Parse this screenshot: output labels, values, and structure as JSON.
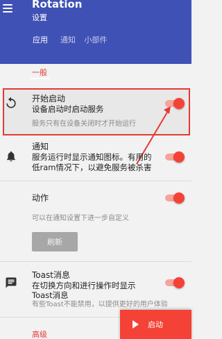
{
  "appbar": {
    "title": "Rotation",
    "subtitle": "设置",
    "tabs": [
      {
        "label": "应用",
        "active": true
      },
      {
        "label": "通知",
        "active": false
      },
      {
        "label": "小部件",
        "active": false
      }
    ]
  },
  "sections": {
    "general_header": "一般",
    "advanced_header": "高级"
  },
  "items": {
    "start_on_boot": {
      "title": "开始启动",
      "subtitle": "设备启动时启动服务",
      "note": "服务只有在设备关闭时才开始运行",
      "enabled": true
    },
    "notification": {
      "title": "通知",
      "subtitle_line1": "服务运行时显示通知图标。有用的",
      "subtitle_line2": "低ram情况下，以避免服务被杀害",
      "enabled": true
    },
    "action": {
      "title": "动作",
      "note": "可以在通知设置下进一步自定义",
      "enabled": true,
      "refresh_label": "刷新"
    },
    "toast": {
      "title": "Toast消息",
      "subtitle_line1": "在切换方向和进行操作时显示",
      "subtitle_line2": "Toast消息",
      "note": "有些Toast不能禁用，以提供更好的用户体验",
      "enabled": true
    }
  },
  "fab": {
    "label": "启动"
  },
  "colors": {
    "primary": "#3f51b5",
    "accent": "#f44336",
    "annotation": "#e53935"
  },
  "icons": {
    "menu": "menu-icon",
    "boot": "restart-icon",
    "notification": "bell-icon",
    "toast": "message-icon",
    "fab": "play-icon"
  }
}
